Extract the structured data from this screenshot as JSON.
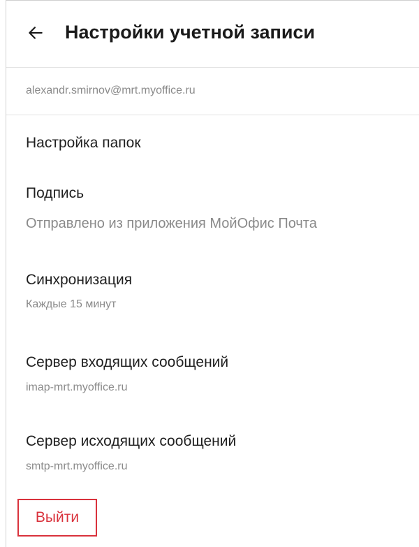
{
  "header": {
    "back_icon": "arrow-left-icon",
    "title": "Настройки учетной записи"
  },
  "account": {
    "email": "alexandr.smirnov@mrt.myoffice.ru"
  },
  "settings": {
    "folders": {
      "title": "Настройка папок"
    },
    "signature": {
      "title": "Подпись",
      "value": "Отправлено из приложения МойОфис Почта"
    },
    "sync": {
      "title": "Синхронизация",
      "value": "Каждые 15 минут"
    },
    "incoming_server": {
      "title": "Сервер входящих сообщений",
      "value": "imap-mrt.myoffice.ru"
    },
    "outgoing_server": {
      "title": "Сервер исходящих сообщений",
      "value": "smtp-mrt.myoffice.ru"
    }
  },
  "logout": {
    "label": "Выйти",
    "color": "#d9323c"
  },
  "colors": {
    "highlight_border": "#d9323c",
    "secondary_text": "#8a8a8a",
    "divider": "#e3e3e3"
  }
}
